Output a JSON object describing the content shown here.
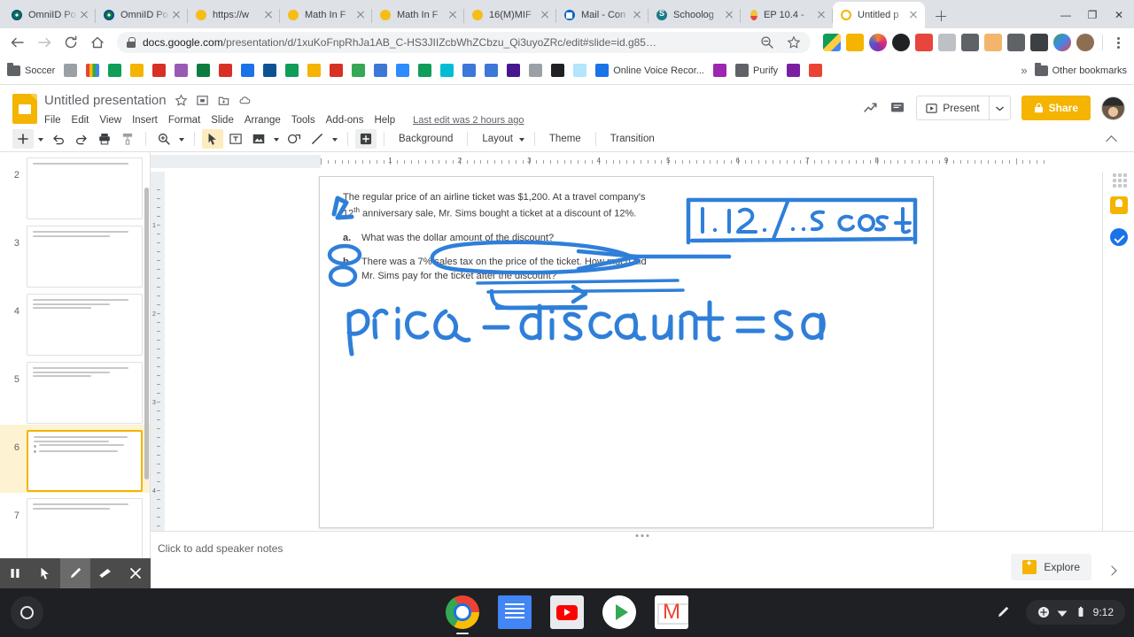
{
  "browser": {
    "tabs": [
      {
        "title": "OmniID Po",
        "favicon": "omnid-icon",
        "active": false
      },
      {
        "title": "OmniID Po",
        "favicon": "omnid-icon",
        "active": false
      },
      {
        "title": "https://w",
        "favicon": "yellow-dot-icon",
        "active": false
      },
      {
        "title": "Math In F",
        "favicon": "yellow-dot-icon",
        "active": false
      },
      {
        "title": "Math In F",
        "favicon": "yellow-dot-icon",
        "active": false
      },
      {
        "title": "16(M)MIF",
        "favicon": "yellow-dot-icon",
        "active": false
      },
      {
        "title": "Mail - Con",
        "favicon": "outlook-icon",
        "active": false
      },
      {
        "title": "Schoolog",
        "favicon": "schoology-icon",
        "active": false
      },
      {
        "title": "EP 10.4 -",
        "favicon": "pencil-icon",
        "active": false
      },
      {
        "title": "Untitled p",
        "favicon": "google-slides-icon",
        "active": true
      }
    ],
    "new_tab_label": "+",
    "window_controls": [
      "minimize",
      "restore",
      "close"
    ],
    "nav": {
      "back": "back-arrow-icon",
      "forward": "forward-arrow-icon",
      "reload": "reload-icon",
      "home": "home-icon"
    },
    "omnibox": {
      "secure_icon": "lock-icon",
      "url_domain": "docs.google.com",
      "url_path": "/presentation/d/1xuKoFnpRhJa1AB_C-HS3JIIZcbWhZCbzu_Qi3uyoZRc/edit#slide=id.g85…",
      "zoom_icon": "zoom-out-icon",
      "bookmark_icon": "star-icon"
    },
    "extensions": [
      "google-drive-icon",
      "contacts-icon",
      "camera-icon",
      "penguin-icon",
      "bloom-icon",
      "b-icon",
      "grid-icon",
      "bitmoji-icon",
      "scissors-icon",
      "reader-icon",
      "heart-icon",
      "palette-icon"
    ],
    "menu_icon": "three-dot-menu-icon",
    "bookmarks": {
      "items": [
        {
          "label": "Soccer",
          "icon": "folder-icon"
        },
        {
          "label": "",
          "icon": "excel-icon"
        },
        {
          "label": "",
          "icon": "books-icon"
        },
        {
          "label": "",
          "icon": "ixl-icon"
        },
        {
          "label": "",
          "icon": "contacts-icon"
        },
        {
          "label": "",
          "icon": "t-icon"
        },
        {
          "label": "",
          "icon": "clock-icon"
        },
        {
          "label": "",
          "icon": "omnid-icon"
        },
        {
          "label": "",
          "icon": "target-icon"
        },
        {
          "label": "",
          "icon": "globe-icon"
        },
        {
          "label": "",
          "icon": "omnid2-icon"
        },
        {
          "label": "",
          "icon": "tree-icon"
        },
        {
          "label": "",
          "icon": "notes-icon"
        },
        {
          "label": "",
          "icon": "c-icon"
        },
        {
          "label": "",
          "icon": "share-icon"
        },
        {
          "label": "",
          "icon": "m-icon"
        },
        {
          "label": "",
          "icon": "zoom-app-icon"
        },
        {
          "label": "",
          "icon": "bowtie-icon"
        },
        {
          "label": "",
          "icon": "c-circle-icon"
        },
        {
          "label": "",
          "icon": "calendar-icon"
        },
        {
          "label": "",
          "icon": "table-icon"
        },
        {
          "label": "",
          "icon": "kahoot-icon"
        },
        {
          "label": "",
          "icon": "seal-icon"
        },
        {
          "label": "",
          "icon": "n-icon"
        },
        {
          "label": "",
          "icon": "molecule-icon"
        },
        {
          "label": "Online Voice Recor...",
          "icon": "microphone-icon"
        },
        {
          "label": "",
          "icon": "question-icon"
        },
        {
          "label": "Purify",
          "icon": "globe-dark-icon"
        },
        {
          "label": "",
          "icon": "sixty-icon"
        },
        {
          "label": "",
          "icon": "lm-icon"
        }
      ],
      "overflow_label": "»",
      "other_bookmarks_label": "Other bookmarks"
    }
  },
  "slides": {
    "doc_title": "Untitled presentation",
    "title_icons": [
      "star-icon",
      "move-to-folder-icon",
      "add-to-drive-icon",
      "cloud-status-icon"
    ],
    "menus": [
      "File",
      "Edit",
      "View",
      "Insert",
      "Format",
      "Slide",
      "Arrange",
      "Tools",
      "Add-ons",
      "Help"
    ],
    "last_edit": "Last edit was 2 hours ago",
    "header_right": {
      "activity_icon": "activity-dashboard-icon",
      "comment_icon": "comment-icon",
      "present_label": "Present",
      "present_dropdown": "chevron-down-icon",
      "share_label": "Share",
      "share_lock_icon": "lock-icon",
      "avatar": "user-avatar"
    },
    "toolbar": {
      "new_slide_icon": "add-slide-icon",
      "undo_icon": "undo-icon",
      "redo_icon": "redo-icon",
      "print_icon": "print-icon",
      "paint_icon": "paint-format-icon",
      "zoom_icon": "zoom-icon",
      "select_icon": "select-cursor-icon",
      "textbox_icon": "text-box-icon",
      "image_icon": "insert-image-icon",
      "shape_icon": "shape-icon",
      "line_icon": "line-icon",
      "comment_icon": "add-comment-icon",
      "background_label": "Background",
      "layout_label": "Layout",
      "theme_label": "Theme",
      "transition_label": "Transition",
      "collapse_icon": "collapse-toolbar-icon"
    },
    "filmstrip": [
      {
        "number": "2",
        "active": false,
        "lines": 1,
        "bullets": 0
      },
      {
        "number": "3",
        "active": false,
        "lines": 2,
        "bullets": 0
      },
      {
        "number": "4",
        "active": false,
        "lines": 3,
        "bullets": 0
      },
      {
        "number": "5",
        "active": false,
        "lines": 3,
        "bullets": 0
      },
      {
        "number": "6",
        "active": true,
        "lines": 2,
        "bullets": 2
      },
      {
        "number": "7",
        "active": false,
        "lines": 2,
        "bullets": 0
      }
    ],
    "ruler": {
      "numbers": [
        "1",
        "2",
        "3",
        "4",
        "5",
        "6",
        "7",
        "8",
        "9"
      ],
      "vnumbers": [
        "1",
        "2",
        "3",
        "4"
      ]
    },
    "slide_content": {
      "problem_line1": "The regular price of an airline ticket was $1,200. At a travel company's",
      "problem_line2_pre": "12",
      "problem_line2_sup": "th",
      "problem_line2_post": " anniversary sale, Mr. Sims bought a ticket at a discount of 12%.",
      "part_a_label": "a.",
      "part_a_text": "What was the dollar amount of the discount?",
      "part_b_label": "b.",
      "part_b_text_line1": "There was a 7% sales tax on the price of the ticket. How much did",
      "part_b_text_line2": "Mr. Sims pay for the ticket after the discount?",
      "ink_annotations": [
        {
          "name": "boxed-note",
          "text": "1 . 12 % . .5 cost"
        },
        {
          "name": "equation-note",
          "text": "price - discount = sa"
        },
        {
          "name": "circle-a",
          "text": "a"
        },
        {
          "name": "circle-b",
          "text": "b"
        },
        {
          "name": "digit-mark",
          "text": "12"
        }
      ],
      "ink_color": "#2f7fd9"
    },
    "notes_placeholder": "Click to add speaker notes",
    "explore_label": "Explore",
    "explore_icon": "explore-icon",
    "side_panel": [
      "grid-apps-icon",
      "google-keep-icon",
      "google-tasks-icon"
    ],
    "annotation_tools": [
      {
        "name": "pause-button",
        "icon": "pause-icon",
        "selected": false
      },
      {
        "name": "pointer-button",
        "icon": "cursor-icon",
        "selected": false
      },
      {
        "name": "pen-button",
        "icon": "pen-icon",
        "selected": true
      },
      {
        "name": "eraser-button",
        "icon": "eraser-icon",
        "selected": false
      },
      {
        "name": "close-annotation-button",
        "icon": "close-icon",
        "selected": false
      }
    ]
  },
  "shelf": {
    "launcher_icon": "launcher-icon",
    "apps": [
      {
        "name": "chrome",
        "label": "Chrome"
      },
      {
        "name": "docs",
        "label": "Google Docs"
      },
      {
        "name": "youtube",
        "label": "YouTube"
      },
      {
        "name": "play",
        "label": "Play Store"
      },
      {
        "name": "gmail",
        "label": "Gmail"
      }
    ],
    "stylus_icon": "stylus-icon",
    "tray": {
      "network_icon": "network-icon",
      "wifi_icon": "wifi-icon",
      "battery_icon": "battery-icon",
      "clock": "9:12"
    }
  },
  "colors": {
    "brand_yellow": "#f4b400",
    "ink_blue": "#2f7fd9",
    "chrome_frame": "#dee1e6",
    "shelf_bg": "#1f2023"
  }
}
